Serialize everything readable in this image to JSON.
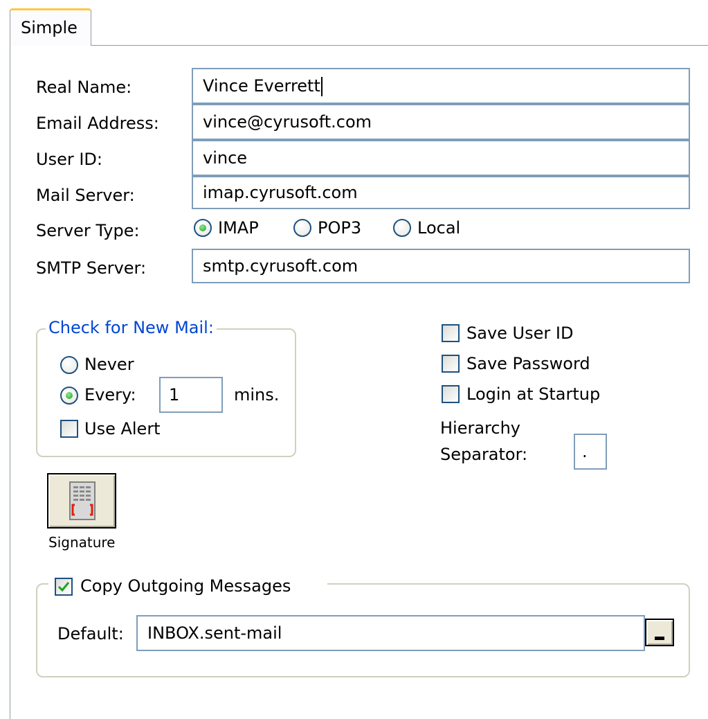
{
  "tab": {
    "label": "Simple"
  },
  "fields": {
    "real_name": {
      "label": "Real Name:",
      "value": "Vince Everrett"
    },
    "email": {
      "label": "Email Address:",
      "value": "vince@cyrusoft.com"
    },
    "user_id": {
      "label": "User ID:",
      "value": "vince"
    },
    "mail_server": {
      "label": "Mail Server:",
      "value": "imap.cyrusoft.com"
    },
    "server_type": {
      "label": "Server Type:",
      "options": [
        "IMAP",
        "POP3",
        "Local"
      ],
      "selected": "IMAP"
    },
    "smtp_server": {
      "label": "SMTP Server:",
      "value": "smtp.cyrusoft.com"
    }
  },
  "check_mail": {
    "title": "Check for New Mail:",
    "never_label": "Never",
    "every_label": "Every:",
    "selected": "Every:",
    "interval_value": "1",
    "unit_label": "mins.",
    "use_alert_label": "Use Alert",
    "use_alert_checked": false
  },
  "options": {
    "save_user_id": {
      "label": "Save User ID",
      "checked": false
    },
    "save_password": {
      "label": "Save Password",
      "checked": false
    },
    "login_at_startup": {
      "label": "Login at Startup",
      "checked": false
    },
    "hierarchy_label_line1": "Hierarchy",
    "hierarchy_label_line2": "Separator:",
    "hierarchy_value": "."
  },
  "signature": {
    "label": "Signature",
    "icon": "signature-icon"
  },
  "copy_outgoing": {
    "label": "Copy Outgoing Messages",
    "checked": true,
    "default_label": "Default:",
    "default_value": "INBOX.sent-mail"
  },
  "colors": {
    "group_title": "#0046d5",
    "border": "#7f9db9",
    "tab_highlight": "#ffc83c",
    "radio_dot": "#21a121",
    "check_mark": "#21a121"
  }
}
